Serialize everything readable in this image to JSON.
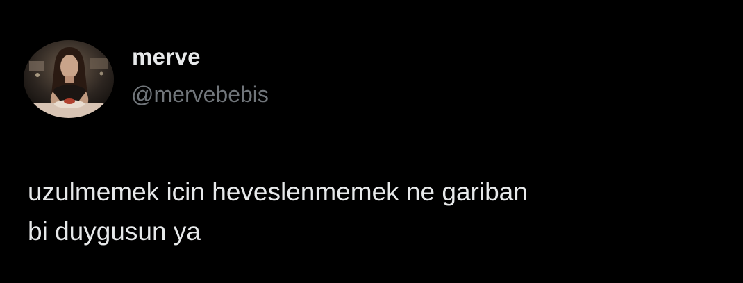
{
  "author": {
    "display_name": "merve",
    "handle": "@mervebebis",
    "avatar_icon": "profile-photo"
  },
  "tweet": {
    "lines": [
      "uzulmemek icin heveslenmemek ne gariban",
      "bi duygusun ya"
    ]
  },
  "colors": {
    "background": "#000000",
    "primary_text": "#e7e9ea",
    "secondary_text": "#71767b"
  }
}
